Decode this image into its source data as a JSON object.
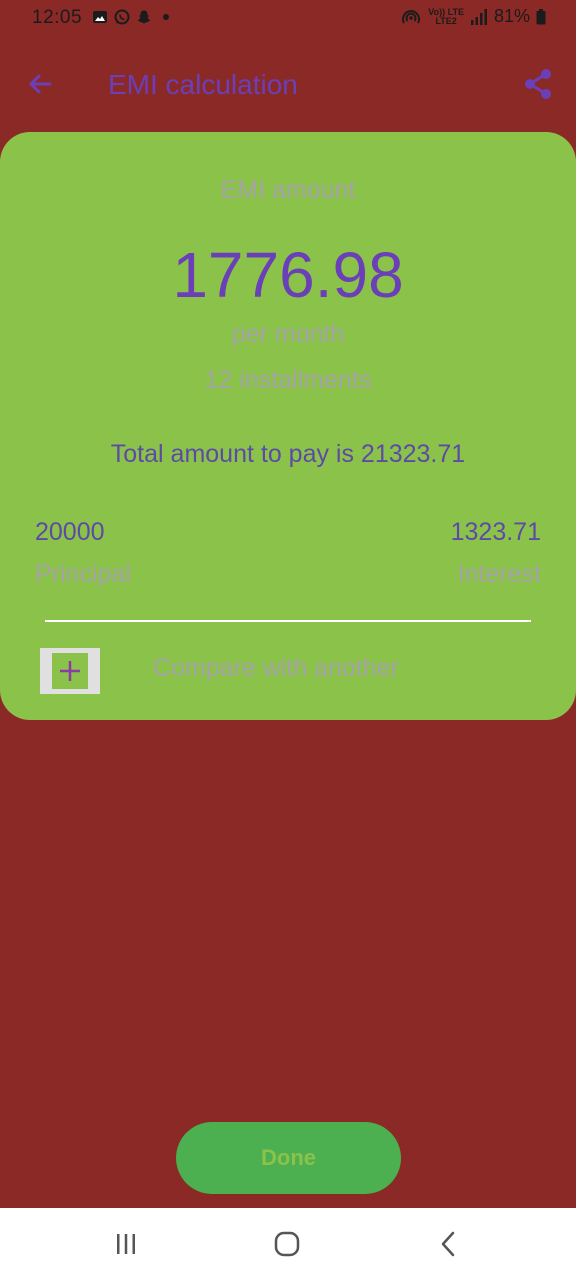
{
  "status_bar": {
    "time": "12:05",
    "battery": "81%",
    "network_top": "Vo)) LTE",
    "network_bottom": "LTE2"
  },
  "app_bar": {
    "title": "EMI calculation"
  },
  "result": {
    "emi_label": "EMI amount",
    "emi_value": "1776.98",
    "per_month": "per month",
    "installments": "12 installments",
    "total_text": "Total amount to pay is 21323.71",
    "principal_value": "20000",
    "principal_label": "Principal",
    "interest_value": "1323.71",
    "interest_label": "Interest",
    "compare_label": "Compare with another"
  },
  "done_label": "Done",
  "colors": {
    "background": "#8b2926",
    "card": "#8bc34a",
    "accent": "#6a3fb8",
    "done_button": "#4caf50"
  },
  "icons": {
    "back": "arrow-left-icon",
    "share": "share-icon",
    "compare": "plus-icon",
    "nav_recents": "recents-icon",
    "nav_home": "home-icon",
    "nav_back": "back-chevron-icon"
  }
}
